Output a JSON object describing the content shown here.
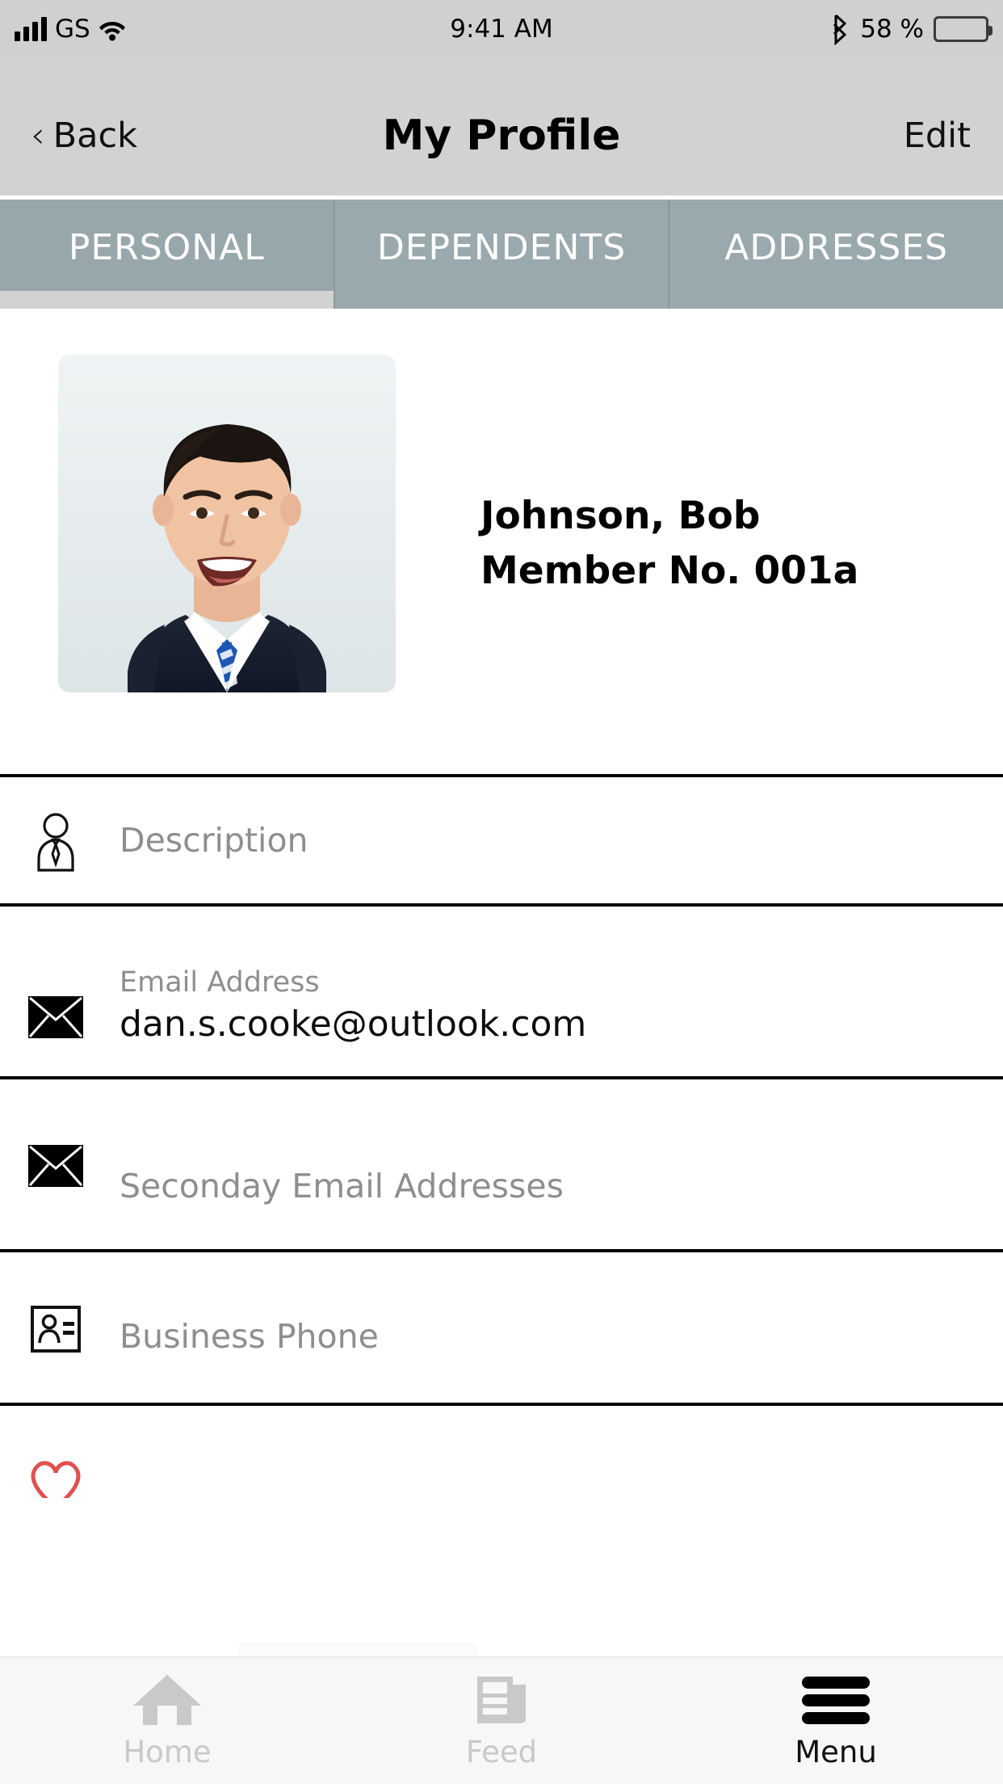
{
  "status_bar": {
    "carrier": "GS",
    "time": "9:41 AM",
    "battery_percent": "58 %",
    "icons": {
      "signal": "signal-bars-icon",
      "wifi": "wifi-icon",
      "bluetooth": "bluetooth-icon",
      "battery": "battery-icon"
    }
  },
  "nav": {
    "back_label": "Back",
    "back_chevron": "‹",
    "title": "My Profile",
    "edit_label": "Edit"
  },
  "segmented_tabs": {
    "active_index": 0,
    "items": [
      {
        "label": "PERSONAL"
      },
      {
        "label": "DEPENDENTS"
      },
      {
        "label": "ADDRESSES"
      }
    ]
  },
  "profile": {
    "avatar_alt": "profile-photo-man-in-suit-and-blue-striped-tie",
    "name": "Johnson, Bob",
    "member_no": "Member No. 001a"
  },
  "fields": [
    {
      "icon": "person-with-tie-icon",
      "placeholder": "Description",
      "sublabel": "",
      "value": ""
    },
    {
      "icon": "envelope-icon",
      "placeholder": "",
      "sublabel": "Email Address",
      "value": "dan.s.cooke@outlook.com"
    },
    {
      "icon": "envelope-icon",
      "placeholder": "Seconday Email Addresses",
      "sublabel": "",
      "value": ""
    },
    {
      "icon": "contact-card-icon",
      "placeholder": "Business Phone",
      "sublabel": "",
      "value": ""
    }
  ],
  "bottom_tabs": {
    "active_index": 2,
    "items": [
      {
        "label": "Home",
        "icon": "home-icon"
      },
      {
        "label": "Feed",
        "icon": "newspaper-icon"
      },
      {
        "label": "Menu",
        "icon": "hamburger-menu-icon"
      }
    ]
  },
  "colors": {
    "status_bar_bg": "#d0d0d0",
    "nav_bg": "#d2d2d2",
    "segment_bg": "#9aa9ad",
    "segment_indicator": "#d2d2d2",
    "placeholder_text": "#8e8e8e",
    "tabbar_bg": "#f7f7f7",
    "tab_inactive": "#c9c9c9",
    "tab_active": "#111111"
  }
}
